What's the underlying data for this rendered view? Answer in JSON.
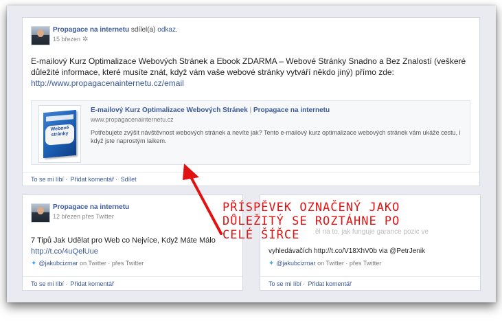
{
  "main_post": {
    "author": "Propagace na internetu",
    "shared_text": "sdílel(a)",
    "shared_link": "odkaz.",
    "date": "15 březen",
    "text": "E-mailový Kurz Optimalizace Webových Stránek a Ebook ZDARMA – Webové Stránky Snadno a Bez Znalostí (veškeré důležité informace, které musíte znát, když vám vaše webové stránky vytváří někdo jiný) přímo zde:",
    "url": "http://www.propagacenainternetu.cz/email",
    "share": {
      "thumb_text": "Webové stránky",
      "title": "E-mailový Kurz Optimalizace Webových Stránek",
      "separator": "|",
      "site": "Propagace na internetu",
      "domain": "www.propagacenainternetu.cz",
      "description": "Potřebujete zvýšit návštěvnost webových stránek a nevíte jak? Tento e-mailový kurz optimalizace webových stránek vám ukáže cestu, i když jste naprostým laikem."
    },
    "actions": {
      "like": "To se mi líbí",
      "comment": "Přidat komentář",
      "share": "Sdílet"
    }
  },
  "left_post": {
    "author": "Propagace na internetu",
    "date": "12 březen přes Twitter",
    "text": "7 Tipů Jak Udělat pro Web co Nejvíce, Když Máte Málo",
    "link": "http://t.co/4uQelUue",
    "twitter_handle": "@jakubcizmar",
    "twitter_suffix": "on Twitter · přes Twitter",
    "actions": {
      "like": "To se mi líbí",
      "comment": "Přidat komentář"
    }
  },
  "right_post": {
    "faint_text": "vyhledávačích http://t.co/V18XhV0b via @PetrJenik",
    "faint_text_2": "ěl na to, jak funguje garance pozic ve",
    "twitter_handle": "@jakubcizmar",
    "twitter_suffix": "on Twitter · přes Twitter",
    "actions": {
      "like": "To se mi líbí",
      "comment": "Přidat komentář"
    }
  },
  "annotation": {
    "line1": "PŘÍSPĚVEK OZNAČENÝ JAKO",
    "line2": "DŮLEŽITÝ SE ROZTÁHNE PO",
    "line3": "CELÉ ŠÍŘCE",
    "color": "#e11212"
  },
  "icons": {
    "gear": "gear-icon",
    "twitter": "twitter-bird-icon",
    "arrow": "red-arrow"
  }
}
